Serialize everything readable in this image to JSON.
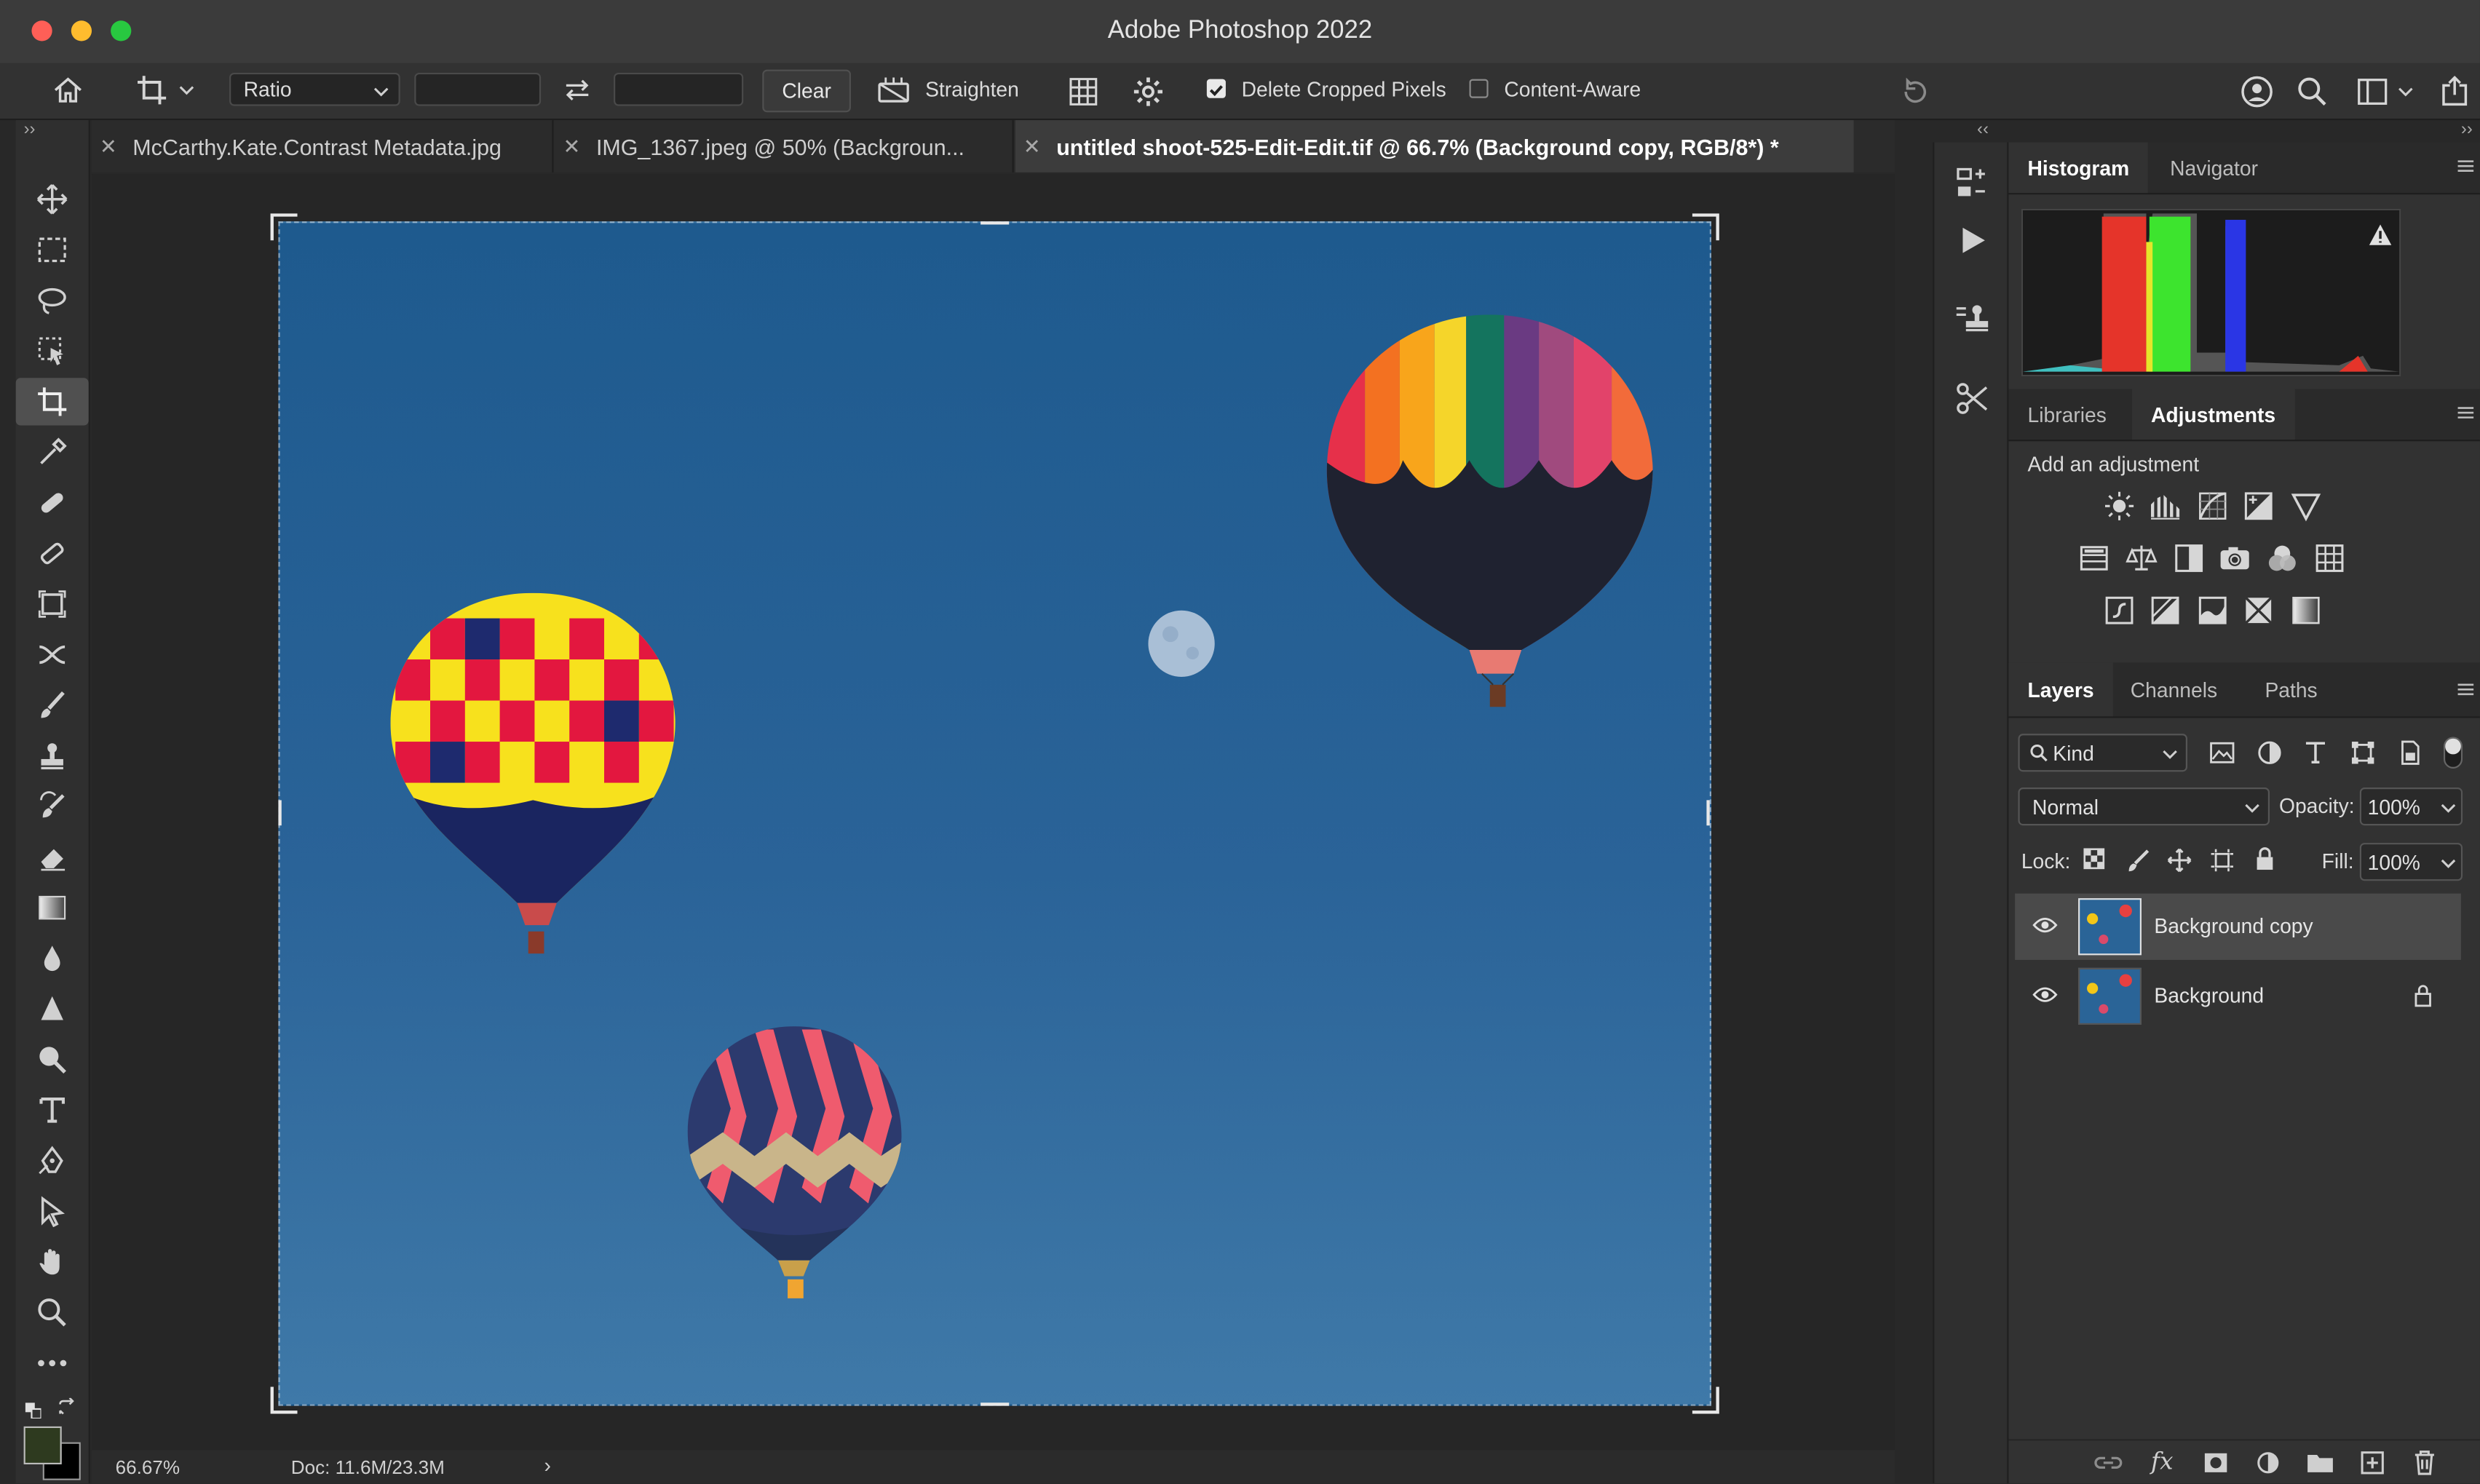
{
  "window": {
    "title": "Adobe Photoshop 2022"
  },
  "options_bar": {
    "ratio_label": "Ratio",
    "clear_label": "Clear",
    "straighten_label": "Straighten",
    "delete_cropped_label": "Delete Cropped Pixels",
    "delete_cropped_checked": true,
    "content_aware_label": "Content-Aware",
    "content_aware_checked": false
  },
  "tabs": [
    {
      "label": "McCarthy.Kate.Contrast Metadata.jpg",
      "active": false
    },
    {
      "label": "IMG_1367.jpeg @ 50% (Backgroun...",
      "active": false
    },
    {
      "label": "untitled shoot-525-Edit-Edit.tif @ 66.7% (Background copy, RGB/8*) *",
      "active": true
    }
  ],
  "status": {
    "zoom": "66.67%",
    "doc": "Doc: 11.6M/23.3M"
  },
  "panels": {
    "histogram_tab": "Histogram",
    "navigator_tab": "Navigator",
    "libraries_tab": "Libraries",
    "adjustments_tab": "Adjustments",
    "add_adjustment": "Add an adjustment",
    "layers_tab": "Layers",
    "channels_tab": "Channels",
    "paths_tab": "Paths"
  },
  "layers_panel": {
    "filter_kind": "Kind",
    "blend_mode": "Normal",
    "opacity_label": "Opacity:",
    "opacity_value": "100%",
    "lock_label": "Lock:",
    "fill_label": "Fill:",
    "fill_value": "100%",
    "layers": [
      {
        "name": "Background copy",
        "selected": true,
        "locked": false
      },
      {
        "name": "Background",
        "selected": false,
        "locked": true
      }
    ]
  },
  "colors": {
    "accent_selection": "#4a4a4a",
    "foreground_swatch": "#2e3a1f",
    "background_swatch": "#000000",
    "traffic_red": "#ff5f57",
    "traffic_yellow": "#febc2e",
    "traffic_green": "#28c840"
  }
}
